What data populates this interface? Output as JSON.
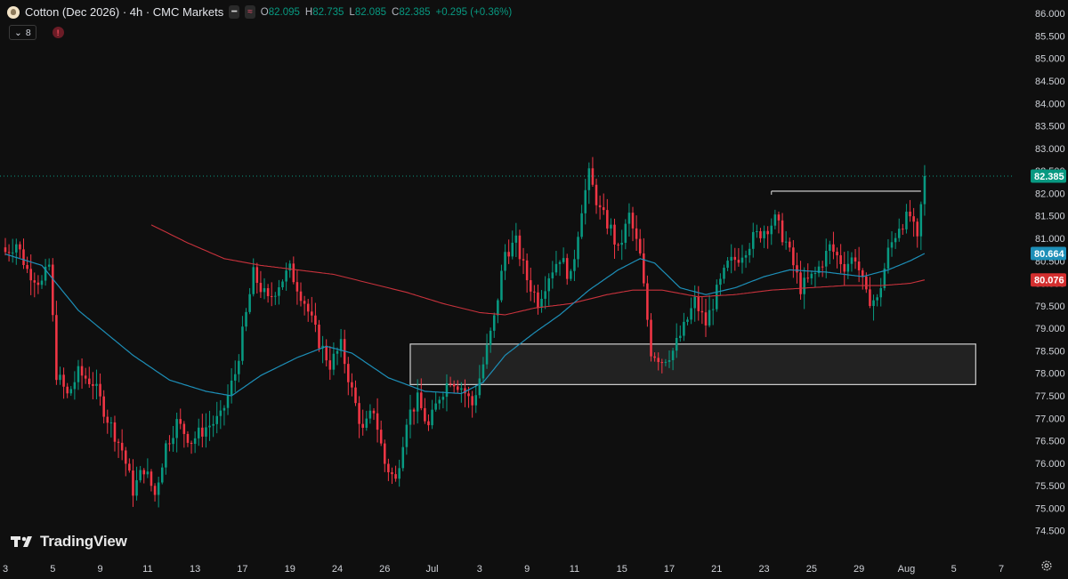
{
  "header": {
    "title": "Cotton (Dec 2026) · 4h · CMC Markets",
    "symbol_icon": "cotton-boll-icon",
    "ohlc": {
      "o_label": "O",
      "o_value": "82.095",
      "h_label": "H",
      "h_value": "82.735",
      "l_label": "L",
      "l_value": "82.085",
      "c_label": "C",
      "c_value": "82.385",
      "change": "+0.295 (+0.36%)"
    },
    "indicator_count": "8"
  },
  "watermark": "TradingView",
  "colors": {
    "up": "#089981",
    "down": "#f23645",
    "ma_fast": "#1d8fb8",
    "ma_slow": "#c8323c",
    "background": "#0f0f0f",
    "zone_fill": "#262626",
    "zone_stroke": "#d0d0d0"
  },
  "chart_data": {
    "type": "candlestick",
    "title": "Cotton (Dec 2026) · 4h · CMC Markets",
    "xlabel": "",
    "ylabel": "",
    "ylim": [
      74.0,
      86.3
    ],
    "yticks": [
      "86.000",
      "85.500",
      "85.000",
      "84.500",
      "84.000",
      "83.500",
      "83.000",
      "82.500",
      "82.000",
      "81.500",
      "81.000",
      "80.500",
      "80.000",
      "79.500",
      "79.000",
      "78.500",
      "78.000",
      "77.500",
      "77.000",
      "76.500",
      "76.000",
      "75.500",
      "75.000",
      "74.500"
    ],
    "xticks": [
      {
        "label": "3",
        "bar": 0
      },
      {
        "label": "5",
        "bar": 13
      },
      {
        "label": "9",
        "bar": 26
      },
      {
        "label": "11",
        "bar": 39
      },
      {
        "label": "13",
        "bar": 52
      },
      {
        "label": "17",
        "bar": 65
      },
      {
        "label": "19",
        "bar": 78
      },
      {
        "label": "24",
        "bar": 91
      },
      {
        "label": "26",
        "bar": 104
      },
      {
        "label": "Jul",
        "bar": 117
      },
      {
        "label": "3",
        "bar": 130
      },
      {
        "label": "9",
        "bar": 143
      },
      {
        "label": "11",
        "bar": 156
      },
      {
        "label": "15",
        "bar": 169
      },
      {
        "label": "17",
        "bar": 182
      },
      {
        "label": "21",
        "bar": 195
      },
      {
        "label": "23",
        "bar": 208
      },
      {
        "label": "25",
        "bar": 221
      },
      {
        "label": "29",
        "bar": 234
      },
      {
        "label": "Aug",
        "bar": 247
      },
      {
        "label": "5",
        "bar": 260
      },
      {
        "label": "7",
        "bar": 273
      }
    ],
    "total_bars": 274,
    "grid": false,
    "current_price": {
      "value": 82.385,
      "label": "82.385"
    },
    "ma_fast_last": {
      "value": 80.664,
      "label": "80.664"
    },
    "ma_slow_last": {
      "value": 80.076,
      "label": "80.076"
    },
    "support_zone": {
      "start_bar": 111,
      "end_bar": 266,
      "low": 77.75,
      "high": 78.65
    },
    "resistance_line": {
      "start_bar": 210,
      "end_bar": 251,
      "value": 82.05
    },
    "close_anchors": [
      [
        0,
        80.7
      ],
      [
        3,
        80.9
      ],
      [
        6,
        80.3
      ],
      [
        10,
        80.0
      ],
      [
        12,
        80.4
      ],
      [
        14,
        78.0
      ],
      [
        17,
        77.5
      ],
      [
        20,
        78.0
      ],
      [
        24,
        77.8
      ],
      [
        28,
        77.0
      ],
      [
        32,
        76.3
      ],
      [
        35,
        75.4
      ],
      [
        38,
        75.9
      ],
      [
        41,
        75.3
      ],
      [
        44,
        76.4
      ],
      [
        47,
        76.9
      ],
      [
        51,
        76.5
      ],
      [
        55,
        76.8
      ],
      [
        59,
        77.0
      ],
      [
        63,
        78.0
      ],
      [
        66,
        79.3
      ],
      [
        68,
        80.2
      ],
      [
        72,
        79.6
      ],
      [
        75,
        80.0
      ],
      [
        78,
        80.3
      ],
      [
        82,
        79.6
      ],
      [
        86,
        78.7
      ],
      [
        89,
        78.2
      ],
      [
        92,
        78.6
      ],
      [
        95,
        77.6
      ],
      [
        98,
        76.7
      ],
      [
        101,
        77.2
      ],
      [
        104,
        76.0
      ],
      [
        107,
        75.6
      ],
      [
        110,
        77.0
      ],
      [
        113,
        77.4
      ],
      [
        116,
        76.8
      ],
      [
        119,
        77.5
      ],
      [
        122,
        77.9
      ],
      [
        125,
        77.7
      ],
      [
        128,
        77.3
      ],
      [
        131,
        78.2
      ],
      [
        134,
        79.2
      ],
      [
        137,
        80.7
      ],
      [
        140,
        80.9
      ],
      [
        143,
        80.1
      ],
      [
        146,
        79.6
      ],
      [
        149,
        80.2
      ],
      [
        152,
        80.6
      ],
      [
        155,
        80.1
      ],
      [
        158,
        81.7
      ],
      [
        160,
        82.4
      ],
      [
        163,
        81.6
      ],
      [
        166,
        81.2
      ],
      [
        168,
        80.7
      ],
      [
        171,
        81.5
      ],
      [
        174,
        80.6
      ],
      [
        177,
        78.5
      ],
      [
        180,
        78.3
      ],
      [
        183,
        78.5
      ],
      [
        186,
        79.0
      ],
      [
        189,
        79.6
      ],
      [
        192,
        79.1
      ],
      [
        195,
        79.8
      ],
      [
        198,
        80.4
      ],
      [
        201,
        80.6
      ],
      [
        205,
        81.0
      ],
      [
        208,
        81.2
      ],
      [
        211,
        81.4
      ],
      [
        214,
        80.9
      ],
      [
        218,
        79.9
      ],
      [
        222,
        80.2
      ],
      [
        226,
        80.8
      ],
      [
        230,
        80.4
      ],
      [
        233,
        80.6
      ],
      [
        236,
        79.7
      ],
      [
        239,
        79.6
      ],
      [
        242,
        80.7
      ],
      [
        245,
        81.3
      ],
      [
        248,
        81.5
      ],
      [
        250,
        80.9
      ],
      [
        251,
        81.7
      ],
      [
        252,
        82.385
      ]
    ],
    "ma_fast_points": [
      [
        0,
        80.65
      ],
      [
        10,
        80.4
      ],
      [
        20,
        79.4
      ],
      [
        35,
        78.4
      ],
      [
        45,
        77.85
      ],
      [
        55,
        77.6
      ],
      [
        62,
        77.5
      ],
      [
        70,
        77.95
      ],
      [
        80,
        78.35
      ],
      [
        88,
        78.6
      ],
      [
        95,
        78.45
      ],
      [
        105,
        77.9
      ],
      [
        115,
        77.6
      ],
      [
        125,
        77.55
      ],
      [
        131,
        77.8
      ],
      [
        137,
        78.4
      ],
      [
        145,
        78.9
      ],
      [
        152,
        79.3
      ],
      [
        160,
        79.85
      ],
      [
        168,
        80.3
      ],
      [
        174,
        80.55
      ],
      [
        178,
        80.45
      ],
      [
        185,
        79.9
      ],
      [
        192,
        79.75
      ],
      [
        200,
        79.9
      ],
      [
        208,
        80.15
      ],
      [
        215,
        80.3
      ],
      [
        225,
        80.25
      ],
      [
        235,
        80.15
      ],
      [
        242,
        80.3
      ],
      [
        248,
        80.5
      ],
      [
        252,
        80.664
      ]
    ],
    "ma_slow_points": [
      [
        40,
        81.3
      ],
      [
        50,
        80.9
      ],
      [
        60,
        80.55
      ],
      [
        70,
        80.4
      ],
      [
        80,
        80.3
      ],
      [
        90,
        80.2
      ],
      [
        100,
        80.0
      ],
      [
        110,
        79.8
      ],
      [
        120,
        79.55
      ],
      [
        130,
        79.35
      ],
      [
        137,
        79.3
      ],
      [
        145,
        79.45
      ],
      [
        155,
        79.55
      ],
      [
        165,
        79.75
      ],
      [
        172,
        79.85
      ],
      [
        180,
        79.85
      ],
      [
        190,
        79.7
      ],
      [
        200,
        79.75
      ],
      [
        210,
        79.85
      ],
      [
        220,
        79.9
      ],
      [
        230,
        79.95
      ],
      [
        240,
        79.95
      ],
      [
        248,
        80.0
      ],
      [
        252,
        80.076
      ]
    ]
  }
}
